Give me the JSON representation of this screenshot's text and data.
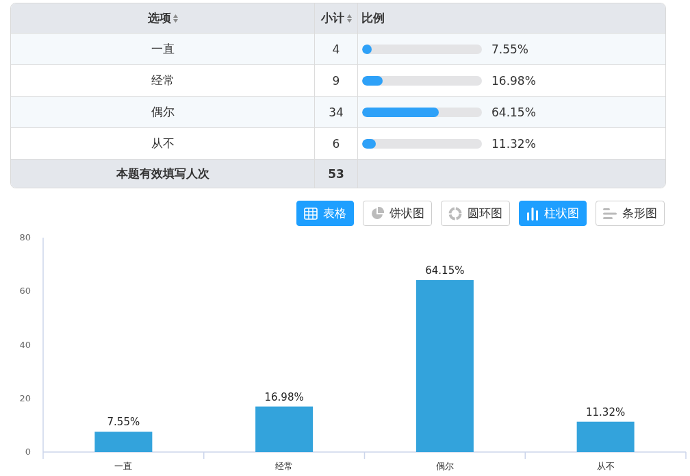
{
  "table": {
    "columns": [
      {
        "label": "选项",
        "sortable": true
      },
      {
        "label": "小计",
        "sortable": true
      },
      {
        "label": "比例",
        "sortable": false
      }
    ],
    "rows": [
      {
        "option": "一直",
        "count": "4",
        "level": 0.0755,
        "percent": "7.55%"
      },
      {
        "option": "经常",
        "count": "9",
        "level": 0.1698,
        "percent": "16.98%"
      },
      {
        "option": "偶尔",
        "count": "34",
        "level": 0.6415,
        "percent": "64.15%"
      },
      {
        "option": "从不",
        "count": "6",
        "level": 0.1132,
        "percent": "11.32%"
      }
    ],
    "footer": {
      "label": "本题有效填写人次",
      "count": "53"
    }
  },
  "view_buttons": [
    {
      "label": "表格",
      "kind": "table",
      "selected": true
    },
    {
      "label": "饼状图",
      "kind": "pie",
      "selected": false
    },
    {
      "label": "圆环图",
      "kind": "donut",
      "selected": false
    },
    {
      "label": "柱状图",
      "kind": "bar",
      "selected": true
    },
    {
      "label": "条形图",
      "kind": "hbar",
      "selected": false
    }
  ],
  "chart": {
    "chart_data": {
      "type": "bar",
      "categories": [
        "一直",
        "经常",
        "偶尔",
        "从不"
      ],
      "series": [
        {
          "color": "#33a3dc",
          "values": [
            7.55,
            16.98,
            64.15,
            11.32
          ]
        }
      ],
      "ylim": [
        0,
        80
      ],
      "yticks": [
        0,
        20,
        40,
        60,
        80
      ],
      "value_labels": [
        "7.55%",
        "16.98%",
        "64.15%",
        "11.32%"
      ]
    }
  }
}
